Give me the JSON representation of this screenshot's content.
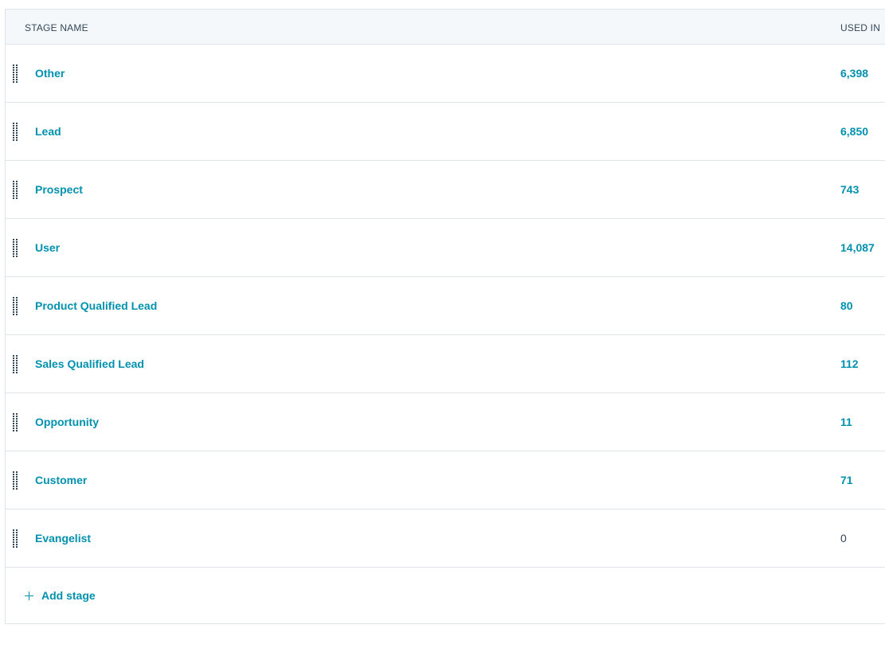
{
  "table": {
    "headers": {
      "stage_name": "STAGE NAME",
      "used_in": "USED IN"
    },
    "rows": [
      {
        "name": "Other",
        "used_in": "6,398"
      },
      {
        "name": "Lead",
        "used_in": "6,850"
      },
      {
        "name": "Prospect",
        "used_in": "743"
      },
      {
        "name": "User",
        "used_in": "14,087"
      },
      {
        "name": "Product Qualified Lead",
        "used_in": "80"
      },
      {
        "name": "Sales Qualified Lead",
        "used_in": "112"
      },
      {
        "name": "Opportunity",
        "used_in": "11"
      },
      {
        "name": "Customer",
        "used_in": "71"
      },
      {
        "name": "Evangelist",
        "used_in": "0"
      }
    ],
    "add_stage_label": "Add stage"
  },
  "colors": {
    "link": "#0091ae",
    "text": "#33475b",
    "header_bg": "#f5f8fa",
    "border": "#dfe3eb"
  },
  "icons": {
    "drag": "drag-handle-icon",
    "add": "plus-icon"
  }
}
